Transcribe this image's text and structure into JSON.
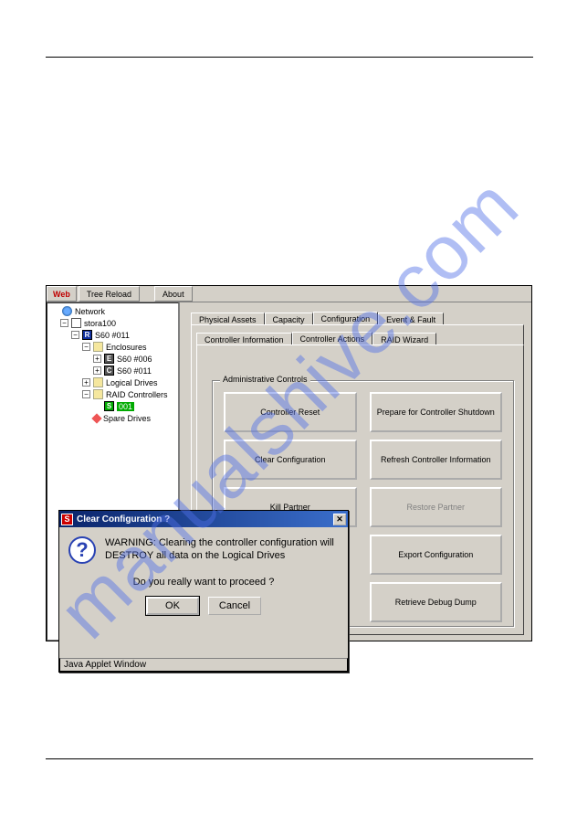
{
  "watermark": "manualshive.com",
  "toolbar": {
    "web": "Web",
    "tree_reload": "Tree Reload",
    "about": "About"
  },
  "tree": {
    "root": "Network",
    "host": "stora100",
    "ctrl": "S60 #011",
    "enclosures": "Enclosures",
    "enc1": "S60 #006",
    "enc2": "S60 #011",
    "logical": "Logical Drives",
    "raid": "RAID Controllers",
    "raid_item": "001",
    "spare": "Spare Drives"
  },
  "tabs": {
    "row1": [
      {
        "label": "Physical Assets",
        "active": false
      },
      {
        "label": "Capacity",
        "active": false
      },
      {
        "label": "Configuration",
        "active": true
      },
      {
        "label": "Event & Fault",
        "active": false
      }
    ],
    "row2": [
      {
        "label": "Controller Information",
        "active": false
      },
      {
        "label": "Controller Actions",
        "active": true
      },
      {
        "label": "RAID Wizard",
        "active": false
      }
    ]
  },
  "group_label": "Administrative Controls",
  "buttons": {
    "controller_reset": "Controller Reset",
    "prepare_shutdown": "Prepare for Controller Shutdown",
    "clear_config": "Clear Configuration",
    "refresh_info": "Refresh Controller Information",
    "kill_partner": "Kill Partner",
    "restore_partner": "Restore Partner",
    "export_config": "Export Configuration",
    "retrieve_dump": "Retrieve Debug Dump"
  },
  "dialog": {
    "title": "Clear Configuration ?",
    "line1": "WARNING: Clearing the controller configuration will",
    "line2": "DESTROY all data on the Logical Drives",
    "prompt": "Do you really want to proceed ?",
    "ok": "OK",
    "cancel": "Cancel",
    "status": "Java Applet Window"
  }
}
